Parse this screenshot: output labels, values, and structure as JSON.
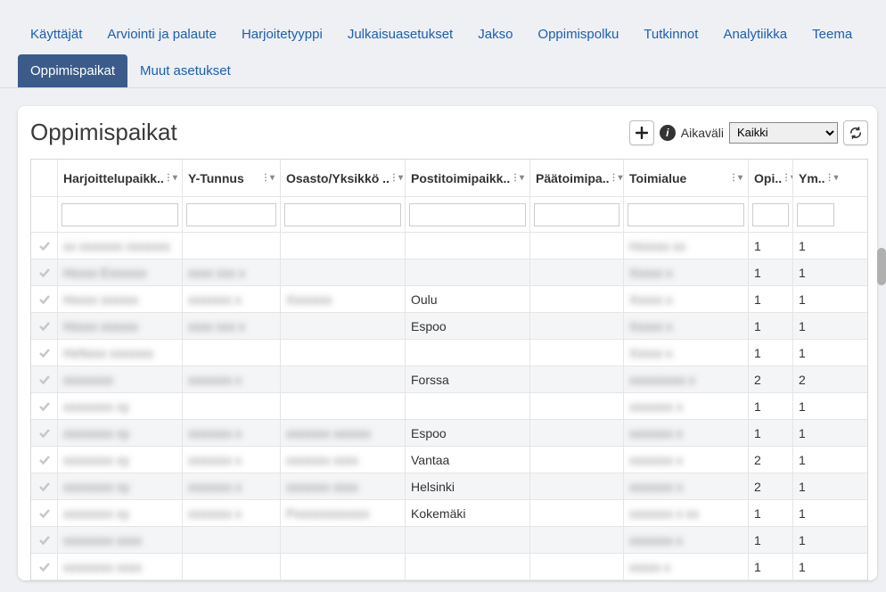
{
  "tabs": [
    {
      "label": "Käyttäjät",
      "active": false
    },
    {
      "label": "Arviointi ja palaute",
      "active": false
    },
    {
      "label": "Harjoitetyyppi",
      "active": false
    },
    {
      "label": "Julkaisuasetukset",
      "active": false
    },
    {
      "label": "Jakso",
      "active": false
    },
    {
      "label": "Oppimispolku",
      "active": false
    },
    {
      "label": "Tutkinnot",
      "active": false
    },
    {
      "label": "Analytiikka",
      "active": false
    },
    {
      "label": "Teema",
      "active": false
    },
    {
      "label": "Oppimispaikat",
      "active": true
    },
    {
      "label": "Muut asetukset",
      "active": false
    }
  ],
  "panel": {
    "title": "Oppimispaikat",
    "interval_label": "Aikaväli",
    "interval_value": "Kaikki"
  },
  "columns": [
    {
      "label": "",
      "filter": false
    },
    {
      "label": "Harjoittelupaikk..",
      "filter": true
    },
    {
      "label": "Y-Tunnus",
      "filter": true
    },
    {
      "label": "Osasto/Yksikkö ..",
      "filter": true
    },
    {
      "label": "Postitoimipaikk..",
      "filter": true
    },
    {
      "label": "Päätoimipa..",
      "filter": true
    },
    {
      "label": "Toimialue",
      "filter": true
    },
    {
      "label": "Opi..",
      "filter": true
    },
    {
      "label": "Ym..",
      "filter": true
    }
  ],
  "rows": [
    {
      "c1": "xx xxxxxxx xxxxxxx",
      "c2": "",
      "c3": "",
      "c4": "",
      "c5": "",
      "c6": "Hxxxxx xx",
      "c7": "1",
      "c8": "1"
    },
    {
      "c1": "Hxxxx Exxxxxx",
      "c2": "xxxx xxx x",
      "c3": "",
      "c4": "",
      "c5": "",
      "c6": "Xxxxx x",
      "c7": "1",
      "c8": "1"
    },
    {
      "c1": "Hxxxx xxxxxx",
      "c2": "xxxxxxx x",
      "c3": "Xxxxxxx",
      "c4": "Oulu",
      "c5": "",
      "c6": "Xxxxx x",
      "c7": "1",
      "c8": "1"
    },
    {
      "c1": "Hxxxx xxxxxx",
      "c2": "xxxx xxx x",
      "c3": "",
      "c4": "Espoo",
      "c5": "",
      "c6": "Xxxxx x",
      "c7": "1",
      "c8": "1"
    },
    {
      "c1": "HxNxxx xxxxxxx",
      "c2": "",
      "c3": "",
      "c4": "",
      "c5": "",
      "c6": "Xxxxx x",
      "c7": "1",
      "c8": "1"
    },
    {
      "c1": "xxxxxxxx",
      "c2": "xxxxxxx x",
      "c3": "",
      "c4": "Forssa",
      "c5": "",
      "c6": "xxxxxxxxx x",
      "c7": "2",
      "c8": "2"
    },
    {
      "c1": "xxxxxxxx xy",
      "c2": "",
      "c3": "",
      "c4": "",
      "c5": "",
      "c6": "xxxxxxx x",
      "c7": "1",
      "c8": "1"
    },
    {
      "c1": "xxxxxxxx xy",
      "c2": "xxxxxxx x",
      "c3": "xxxxxxx xxxxxx",
      "c4": "Espoo",
      "c5": "",
      "c6": "xxxxxxx x",
      "c7": "1",
      "c8": "1"
    },
    {
      "c1": "xxxxxxxx xy",
      "c2": "xxxxxxx x",
      "c3": "xxxxxxx xxxx",
      "c4": "Vantaa",
      "c5": "",
      "c6": "xxxxxxx x",
      "c7": "2",
      "c8": "1"
    },
    {
      "c1": "xxxxxxxx xy",
      "c2": "xxxxxxx x",
      "c3": "xxxxxxx xxxx",
      "c4": "Helsinki",
      "c5": "",
      "c6": "xxxxxxx x",
      "c7": "2",
      "c8": "1"
    },
    {
      "c1": "xxxxxxxx xy",
      "c2": "xxxxxxx x",
      "c3": "Pxxxxxxxxxxxx",
      "c4": "Kokemäki",
      "c5": "",
      "c6": "xxxxxxx x xx",
      "c7": "1",
      "c8": "1"
    },
    {
      "c1": "xxxxxxxx xxxx",
      "c2": "",
      "c3": "",
      "c4": "",
      "c5": "",
      "c6": "xxxxxxx x",
      "c7": "1",
      "c8": "1"
    },
    {
      "c1": "xxxxxxxx xxxx",
      "c2": "",
      "c3": "",
      "c4": "",
      "c5": "",
      "c6": "xxxxx x",
      "c7": "1",
      "c8": "1"
    }
  ],
  "blurred_cols": [
    "c1",
    "c2",
    "c3",
    "c6"
  ]
}
